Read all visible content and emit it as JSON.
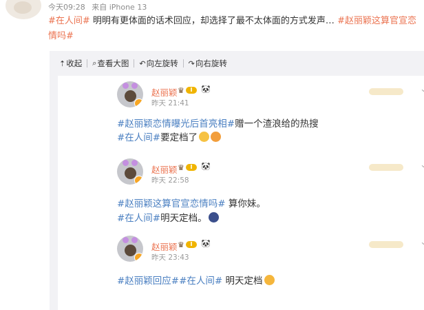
{
  "post": {
    "time": "今天09:28",
    "source": "来自 iPhone 13",
    "text_segments": [
      {
        "text": "#在人间#",
        "tag": true
      },
      {
        "text": " 明明有更体面的话术回应，却选择了最不太体面的方式发声… ",
        "tag": false
      },
      {
        "text": "#赵丽颖这算官宣恋情吗#",
        "tag": true
      }
    ]
  },
  "toolbar": {
    "items": [
      {
        "icon": "collapse-icon",
        "glyph": "⇡",
        "label": "收起"
      },
      {
        "icon": "zoom-icon",
        "glyph": "⌕",
        "label": "查看大图"
      },
      {
        "icon": "rotate-left-icon",
        "glyph": "↶",
        "label": "向左旋转"
      },
      {
        "icon": "rotate-right-icon",
        "glyph": "↷",
        "label": "向右旋转"
      }
    ]
  },
  "comments": [
    {
      "name": "赵丽颖",
      "badge": "I",
      "time": "昨天 21:41",
      "line1": [
        {
          "text": "#赵丽颖恋情曝光后首亮相#",
          "tag": true
        },
        {
          "text": "赠一个渣浪给的热搜",
          "tag": false
        }
      ],
      "line2": [
        {
          "text": "#在人间#",
          "tag": true
        },
        {
          "text": "要定档了",
          "tag": false
        }
      ],
      "emojis": [
        "#f6c243",
        "#f29e3c"
      ]
    },
    {
      "name": "赵丽颖",
      "badge": "I",
      "time": "昨天 22:58",
      "line1": [
        {
          "text": "#赵丽颖这算官宣恋情吗#",
          "tag": true
        },
        {
          "text": " 算你妹。",
          "tag": false
        }
      ],
      "line2": [
        {
          "text": "#在人间#",
          "tag": true
        },
        {
          "text": "明天定档。",
          "tag": false
        }
      ],
      "emojis": [
        "#3b4f8c"
      ]
    },
    {
      "name": "赵丽颖",
      "badge": "I",
      "time": "昨天 23:43",
      "line1": [
        {
          "text": "#赵丽颖回应##在人间#",
          "tag": true
        },
        {
          "text": " 明天定档",
          "tag": false
        }
      ],
      "line2": [],
      "emojis": [
        "#f5b63c"
      ]
    }
  ],
  "colors": {
    "tag_orange": "#eb7350",
    "tag_blue": "#4a7fc1",
    "username": "#eb7350",
    "badge_gold": "#f0b400",
    "gallery_bg": "#f2f2f5"
  }
}
